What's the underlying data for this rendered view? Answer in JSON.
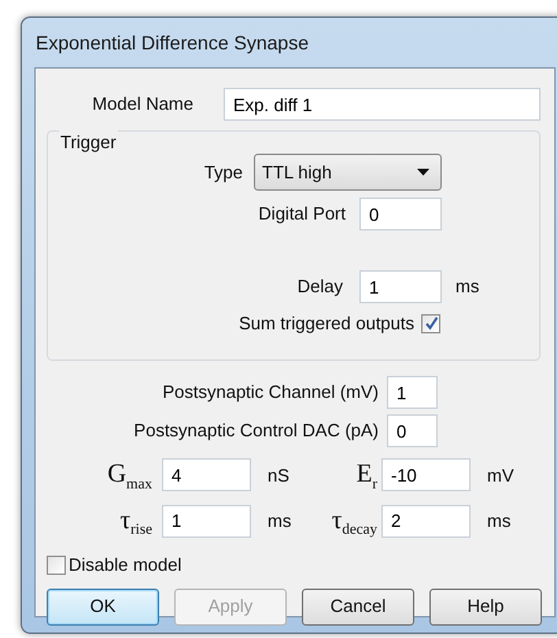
{
  "window": {
    "title": "Exponential Difference Synapse"
  },
  "model_name": {
    "label": "Model Name",
    "value": "Exp. diff 1"
  },
  "trigger": {
    "title": "Trigger",
    "type": {
      "label": "Type",
      "value": "TTL high"
    },
    "digital_port": {
      "label": "Digital Port",
      "value": "0"
    },
    "delay": {
      "label": "Delay",
      "value": "1",
      "unit": "ms"
    },
    "sum_outputs": {
      "label": "Sum triggered outputs",
      "checked": true
    }
  },
  "postsynaptic": [
    {
      "label": "Postsynaptic Channel (mV)",
      "value": "1"
    },
    {
      "label": "Postsynaptic Control DAC (pA)",
      "value": "0"
    }
  ],
  "parameters": [
    {
      "label": "G$_{max}$",
      "value": "4",
      "unit": "nS"
    },
    {
      "label": "E$_{r}$",
      "value": "-10",
      "unit": "mV"
    },
    {
      "label": "τ$_{rise}$",
      "value": "1",
      "unit": "ms"
    },
    {
      "label": "τ$_{decay}$",
      "value": "2",
      "unit": "ms"
    }
  ],
  "disable_model": {
    "label": "Disable model",
    "checked": false
  },
  "buttons": [
    {
      "label": "OK",
      "kind": "default",
      "disabled": false
    },
    {
      "label": "Apply",
      "kind": "normal",
      "disabled": true
    },
    {
      "label": "Cancel",
      "kind": "normal",
      "disabled": false
    },
    {
      "label": "Help",
      "kind": "normal",
      "disabled": false
    }
  ]
}
